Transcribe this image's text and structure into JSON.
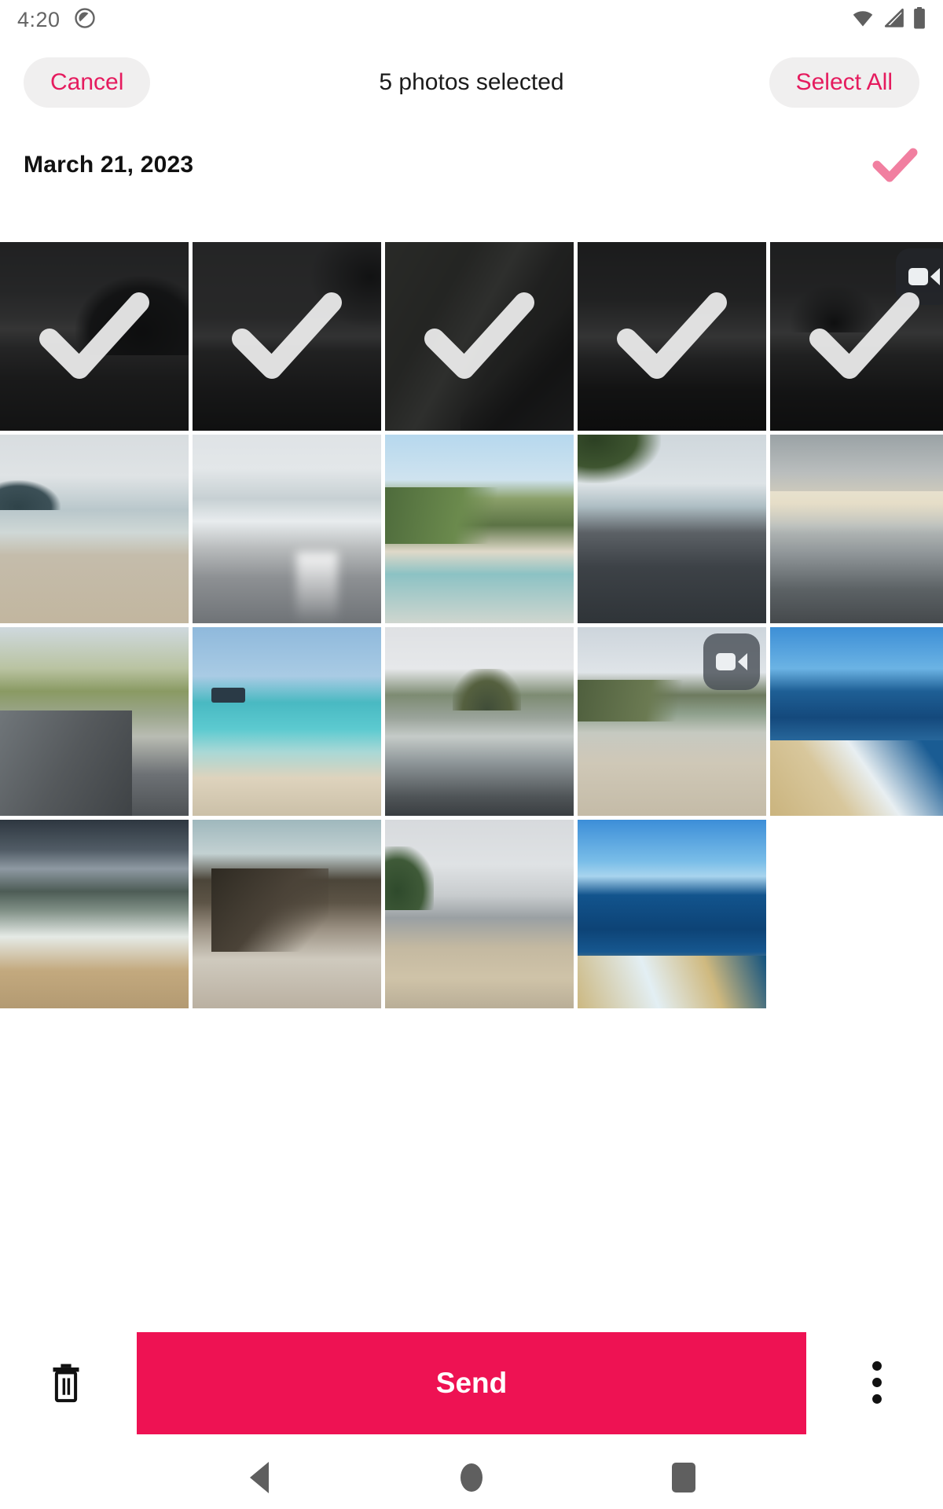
{
  "statusbar": {
    "time": "4:20",
    "left_icons": [
      {
        "name": "do-not-disturb-icon"
      }
    ],
    "right_icons": [
      {
        "name": "wifi-icon"
      },
      {
        "name": "cellular-signal-icon"
      },
      {
        "name": "battery-icon"
      }
    ]
  },
  "appbar": {
    "cancel_label": "Cancel",
    "title": "5 photos selected",
    "select_all_label": "Select All",
    "accent_color": "#E51B5E",
    "pill_bg": "#F0EFEF"
  },
  "date_header": {
    "label": "March 21, 2023",
    "check_icon": "check-icon",
    "check_color": "#F17FA0",
    "checked": true
  },
  "grid": {
    "columns": 5,
    "selected_count": 5,
    "items": [
      {
        "id": 1,
        "style": "p1",
        "selected": true,
        "is_video": false,
        "alt": "Dark rocky shoreline at dusk"
      },
      {
        "id": 2,
        "style": "p2",
        "selected": true,
        "is_video": false,
        "alt": "Grey overcast beach"
      },
      {
        "id": 3,
        "style": "p3",
        "selected": true,
        "is_video": false,
        "alt": "Green hillside over rocky coast"
      },
      {
        "id": 4,
        "style": "p4",
        "selected": true,
        "is_video": false,
        "alt": "Dark sea and sky"
      },
      {
        "id": 5,
        "style": "p5",
        "selected": true,
        "is_video": true,
        "alt": "Dark headland video clip"
      },
      {
        "id": 6,
        "style": "p6",
        "selected": false,
        "is_video": false,
        "alt": "Sandy beach with distant island"
      },
      {
        "id": 7,
        "style": "p7",
        "selected": false,
        "is_video": false,
        "alt": "Sunlit waves on wet sand"
      },
      {
        "id": 8,
        "style": "p8",
        "selected": false,
        "is_video": false,
        "alt": "Green headland and turquoise water"
      },
      {
        "id": 9,
        "style": "p9",
        "selected": false,
        "is_video": false,
        "alt": "Black rocks and island on horizon"
      },
      {
        "id": 10,
        "style": "p10",
        "selected": false,
        "is_video": false,
        "alt": "Hazy sunset over pebble beach"
      },
      {
        "id": 11,
        "style": "p11",
        "selected": false,
        "is_video": false,
        "alt": "Rocky cliff path by the sea"
      },
      {
        "id": 12,
        "style": "p12",
        "selected": false,
        "is_video": false,
        "alt": "Turquoise bay with a boat"
      },
      {
        "id": 13,
        "style": "p13",
        "selected": false,
        "is_video": false,
        "alt": "Conical forested hill over beach"
      },
      {
        "id": 14,
        "style": "p14",
        "selected": false,
        "is_video": true,
        "alt": "Headland and sandy beach video clip"
      },
      {
        "id": 15,
        "style": "p15",
        "selected": false,
        "is_video": false,
        "alt": "Deep blue sea and breakwater blocks"
      },
      {
        "id": 16,
        "style": "p16",
        "selected": false,
        "is_video": false,
        "alt": "Storm clouds over surf"
      },
      {
        "id": 17,
        "style": "p17",
        "selected": false,
        "is_video": false,
        "alt": "Black volcanic rocks in bright sun"
      },
      {
        "id": 18,
        "style": "p18",
        "selected": false,
        "is_video": false,
        "alt": "Hazy city skyline from the shore"
      },
      {
        "id": 19,
        "style": "p19",
        "selected": false,
        "is_video": false,
        "alt": "Blue sky and ocean with concrete blocks"
      }
    ]
  },
  "bottombar": {
    "delete_icon": "trash-icon",
    "send_label": "Send",
    "send_color": "#EE1253",
    "overflow_icon": "more-vertical-icon"
  },
  "navbar": {
    "back_label": "Back",
    "home_label": "Home",
    "recents_label": "Recents"
  }
}
